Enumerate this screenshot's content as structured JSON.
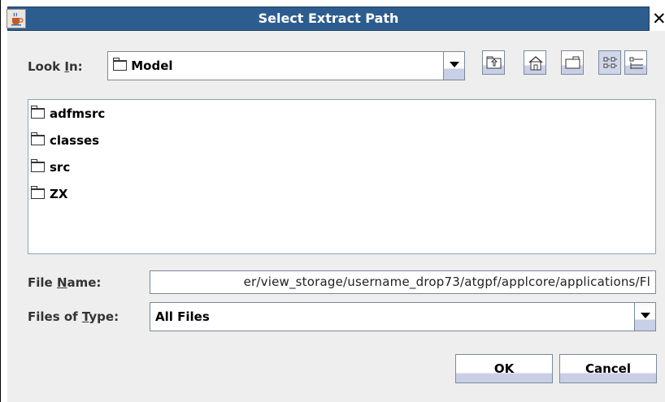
{
  "window": {
    "title": "Select Extract Path",
    "close_glyph": "✕",
    "app_icon": "java-cup-icon"
  },
  "look_in": {
    "label_prefix": "Look ",
    "label_mnemonic": "I",
    "label_suffix": "n:",
    "value": "Model"
  },
  "toolbar": {
    "buttons": [
      "up-one-level-icon",
      "home-icon",
      "new-folder-icon",
      "list-view-icon",
      "details-view-icon"
    ],
    "active": "list-view-icon"
  },
  "files": [
    {
      "name": "adfmsrc",
      "icon": "folder-icon"
    },
    {
      "name": "classes",
      "icon": "folder-icon"
    },
    {
      "name": "src",
      "icon": "folder-icon"
    },
    {
      "name": "ZX",
      "icon": "folder-icon"
    }
  ],
  "file_name": {
    "label_prefix": "File ",
    "label_mnemonic": "N",
    "label_suffix": "ame:",
    "value": "er/view_storage/username_drop73/atgpf/applcore/applications/Fl"
  },
  "files_of_type": {
    "label_prefix": "Files of ",
    "label_mnemonic": "T",
    "label_suffix": "ype:",
    "value": "All Files"
  },
  "buttons": {
    "ok": "OK",
    "cancel": "Cancel"
  },
  "colors": {
    "titlebar": "#2d5d8e",
    "panel": "#eeeeee",
    "button_bottom": "#c9cfe6"
  }
}
